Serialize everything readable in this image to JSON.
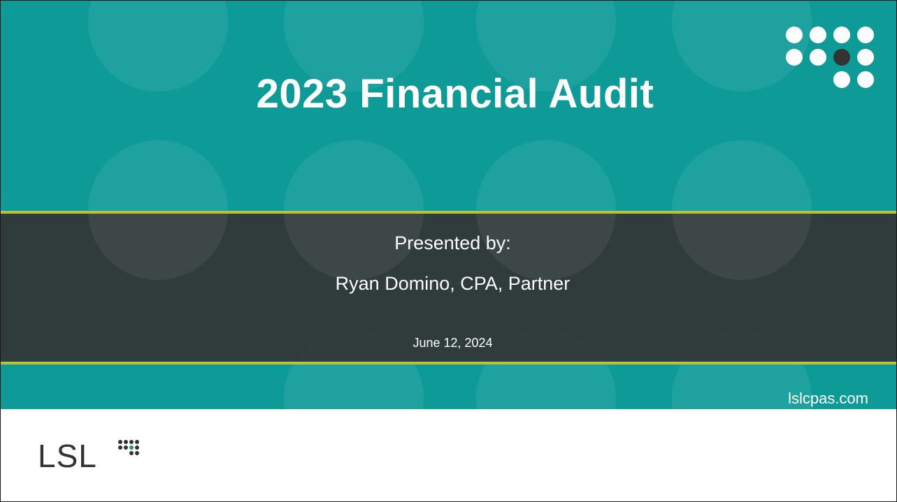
{
  "slide": {
    "title": "2023 Financial Audit",
    "presented_by_label": "Presented by:",
    "presenter": "Ryan Domino, CPA, Partner",
    "date": "June 12, 2024",
    "website": "lslcpas.com",
    "logo_text": "LSL"
  },
  "colors": {
    "teal": "#0e9b98",
    "dark_band": "#333333",
    "gold_line": "#b9c23a",
    "logo_dark": "#333333",
    "accent_dot": "#0e9b98"
  },
  "icons": {
    "corner_logo": "dots-grid-logo",
    "brand_logo": "lsl-dots-logo"
  }
}
